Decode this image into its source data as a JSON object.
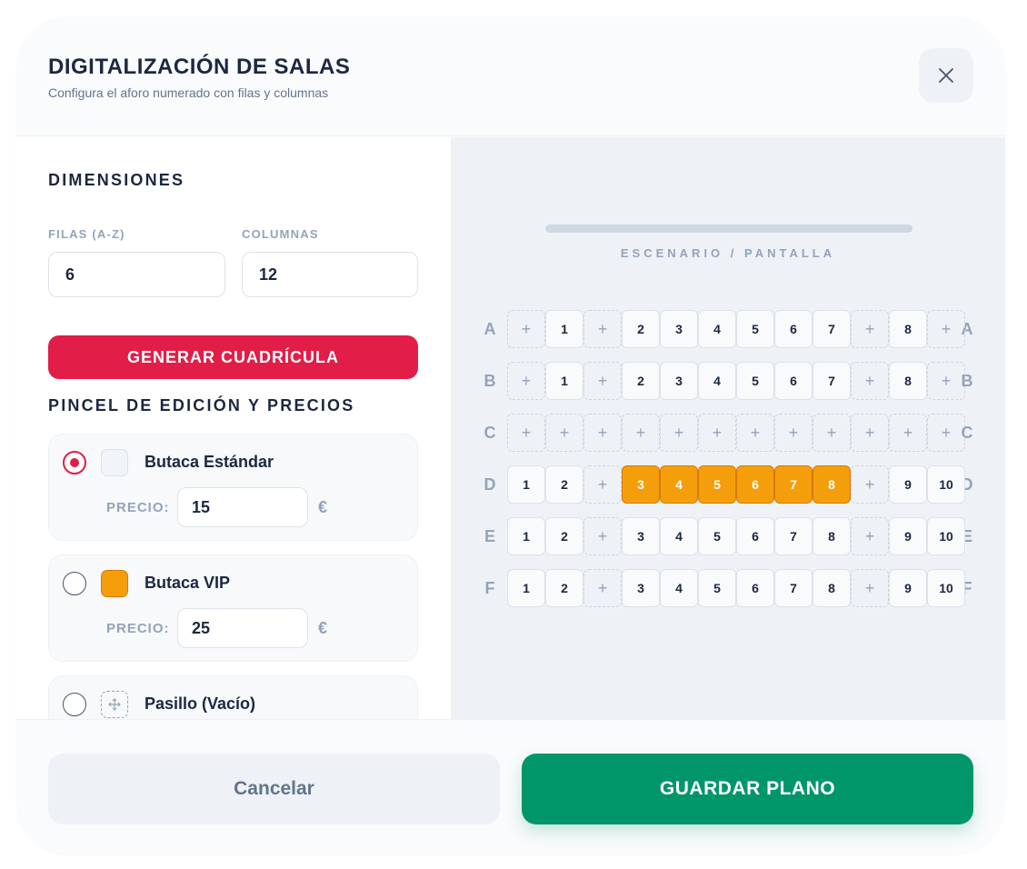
{
  "header": {
    "title": "DIGITALIZACIÓN DE SALAS",
    "subtitle": "Configura el aforo numerado con filas y columnas",
    "close_icon": "close-icon"
  },
  "dimensions": {
    "section_title": "DIMENSIONES",
    "rows_label": "FILAS (A-Z)",
    "rows_value": "6",
    "cols_label": "COLUMNAS",
    "cols_value": "12",
    "generate_label": "GENERAR CUADRÍCULA"
  },
  "brush": {
    "section_title": "PINCEL DE EDICIÓN Y PRECIOS",
    "options": [
      {
        "name": "Butaca Estándar",
        "price_label": "PRECIO:",
        "price": "15",
        "currency": "€",
        "selected": true
      },
      {
        "name": "Butaca VIP",
        "price_label": "PRECIO:",
        "price": "25",
        "currency": "€",
        "selected": false
      },
      {
        "name": "Pasillo (Vacío)",
        "selected": false
      }
    ]
  },
  "stage": {
    "label": "ESCENARIO / PANTALLA"
  },
  "seat_map": {
    "aisle_symbol": "+",
    "rows": [
      {
        "letter": "A",
        "seats": [
          {
            "t": "aisle",
            "l": "+"
          },
          {
            "t": "std",
            "l": "1"
          },
          {
            "t": "aisle",
            "l": "+"
          },
          {
            "t": "std",
            "l": "2"
          },
          {
            "t": "std",
            "l": "3"
          },
          {
            "t": "std",
            "l": "4"
          },
          {
            "t": "std",
            "l": "5"
          },
          {
            "t": "std",
            "l": "6"
          },
          {
            "t": "std",
            "l": "7"
          },
          {
            "t": "aisle",
            "l": "+"
          },
          {
            "t": "std",
            "l": "8"
          },
          {
            "t": "aisle",
            "l": "+"
          }
        ]
      },
      {
        "letter": "B",
        "seats": [
          {
            "t": "aisle",
            "l": "+"
          },
          {
            "t": "std",
            "l": "1"
          },
          {
            "t": "aisle",
            "l": "+"
          },
          {
            "t": "std",
            "l": "2"
          },
          {
            "t": "std",
            "l": "3"
          },
          {
            "t": "std",
            "l": "4"
          },
          {
            "t": "std",
            "l": "5"
          },
          {
            "t": "std",
            "l": "6"
          },
          {
            "t": "std",
            "l": "7"
          },
          {
            "t": "aisle",
            "l": "+"
          },
          {
            "t": "std",
            "l": "8"
          },
          {
            "t": "aisle",
            "l": "+"
          }
        ]
      },
      {
        "letter": "C",
        "seats": [
          {
            "t": "aisle",
            "l": "+"
          },
          {
            "t": "aisle",
            "l": "+"
          },
          {
            "t": "aisle",
            "l": "+"
          },
          {
            "t": "aisle",
            "l": "+"
          },
          {
            "t": "aisle",
            "l": "+"
          },
          {
            "t": "aisle",
            "l": "+"
          },
          {
            "t": "aisle",
            "l": "+"
          },
          {
            "t": "aisle",
            "l": "+"
          },
          {
            "t": "aisle",
            "l": "+"
          },
          {
            "t": "aisle",
            "l": "+"
          },
          {
            "t": "aisle",
            "l": "+"
          },
          {
            "t": "aisle",
            "l": "+"
          }
        ]
      },
      {
        "letter": "D",
        "seats": [
          {
            "t": "std",
            "l": "1"
          },
          {
            "t": "std",
            "l": "2"
          },
          {
            "t": "aisle",
            "l": "+"
          },
          {
            "t": "vip",
            "l": "3"
          },
          {
            "t": "vip",
            "l": "4"
          },
          {
            "t": "vip",
            "l": "5"
          },
          {
            "t": "vip",
            "l": "6"
          },
          {
            "t": "vip",
            "l": "7"
          },
          {
            "t": "vip",
            "l": "8"
          },
          {
            "t": "aisle",
            "l": "+"
          },
          {
            "t": "std",
            "l": "9"
          },
          {
            "t": "std",
            "l": "10"
          }
        ]
      },
      {
        "letter": "E",
        "seats": [
          {
            "t": "std",
            "l": "1"
          },
          {
            "t": "std",
            "l": "2"
          },
          {
            "t": "aisle",
            "l": "+"
          },
          {
            "t": "std",
            "l": "3"
          },
          {
            "t": "std",
            "l": "4"
          },
          {
            "t": "std",
            "l": "5"
          },
          {
            "t": "std",
            "l": "6"
          },
          {
            "t": "std",
            "l": "7"
          },
          {
            "t": "std",
            "l": "8"
          },
          {
            "t": "aisle",
            "l": "+"
          },
          {
            "t": "std",
            "l": "9"
          },
          {
            "t": "std",
            "l": "10"
          }
        ]
      },
      {
        "letter": "F",
        "seats": [
          {
            "t": "std",
            "l": "1"
          },
          {
            "t": "std",
            "l": "2"
          },
          {
            "t": "aisle",
            "l": "+"
          },
          {
            "t": "std",
            "l": "3"
          },
          {
            "t": "std",
            "l": "4"
          },
          {
            "t": "std",
            "l": "5"
          },
          {
            "t": "std",
            "l": "6"
          },
          {
            "t": "std",
            "l": "7"
          },
          {
            "t": "std",
            "l": "8"
          },
          {
            "t": "aisle",
            "l": "+"
          },
          {
            "t": "std",
            "l": "9"
          },
          {
            "t": "std",
            "l": "10"
          }
        ]
      }
    ]
  },
  "footer": {
    "cancel_label": "Cancelar",
    "save_label": "GUARDAR PLANO"
  },
  "colors": {
    "accent": "#e11d48",
    "vip": "#f59e0b",
    "save": "#009669"
  }
}
